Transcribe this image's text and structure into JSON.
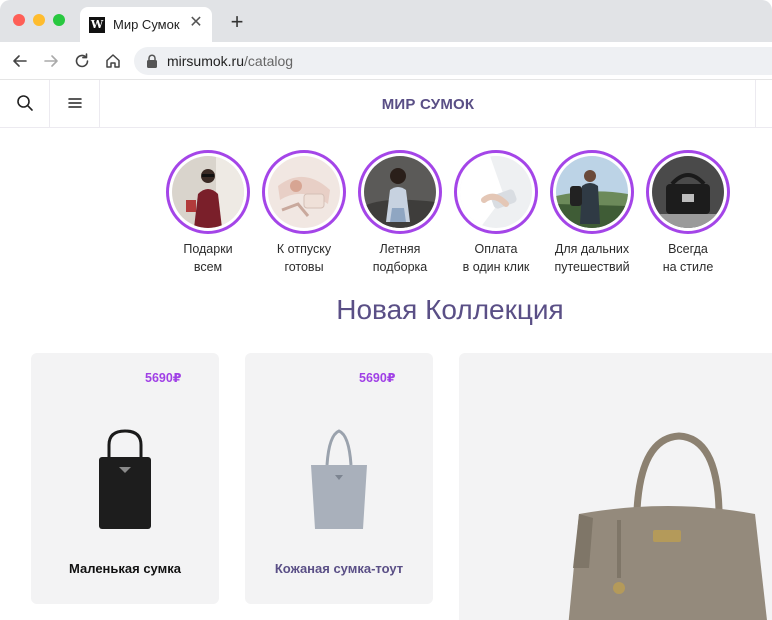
{
  "browser": {
    "tab_title": "Мир Сумок",
    "favicon_letter": "W",
    "tab_close": "✕",
    "new_tab": "+",
    "url_host": "mirsumok.ru",
    "url_path": "/catalog"
  },
  "header": {
    "brand": "МИР СУМОК"
  },
  "stories": [
    {
      "line1": "Подарки",
      "line2": "всем"
    },
    {
      "line1": "К отпуску",
      "line2": "готовы"
    },
    {
      "line1": "Летняя",
      "line2": "подборка"
    },
    {
      "line1": "Оплата",
      "line2": "в один клик"
    },
    {
      "line1": "Для дальних",
      "line2": "путешествий"
    },
    {
      "line1": "Всегда",
      "line2": "на стиле"
    }
  ],
  "collection": {
    "title": "Новая Коллекция"
  },
  "products": [
    {
      "price": "5690₽",
      "name": "Маленькая сумка"
    },
    {
      "price": "5690₽",
      "name": "Кожаная сумка-тоут"
    }
  ],
  "colors": {
    "accent": "#a445e8",
    "brand": "#5a4f86"
  }
}
